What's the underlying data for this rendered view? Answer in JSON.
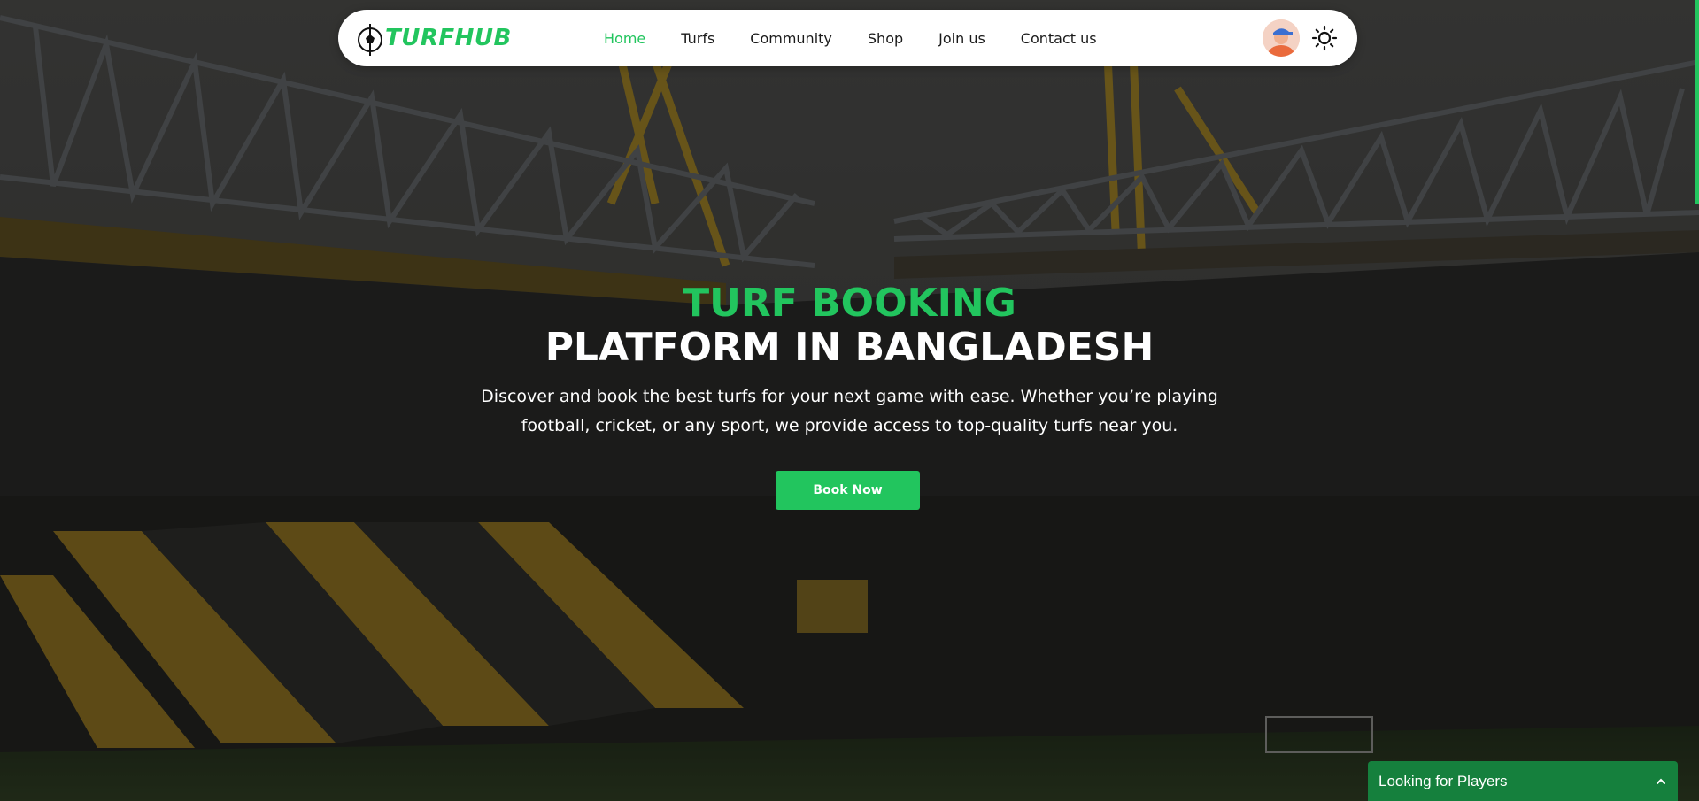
{
  "brand": {
    "name": "TURFHUB",
    "accent_color": "#22c55e"
  },
  "nav": {
    "items": [
      {
        "label": "Home",
        "active": true
      },
      {
        "label": "Turfs",
        "active": false
      },
      {
        "label": "Community",
        "active": false
      },
      {
        "label": "Shop",
        "active": false
      },
      {
        "label": "Join us",
        "active": false
      },
      {
        "label": "Contact us",
        "active": false
      }
    ],
    "avatar_icon": "user-avatar-icon",
    "theme_icon": "sun-icon"
  },
  "hero": {
    "title_line1": "TURF BOOKING",
    "title_line2": "PLATFORM IN BANGLADESH",
    "subtitle_line1": "Discover and book the best turfs for your next game with ease. Whether you’re playing",
    "subtitle_line2": "football, cricket, or any sport, we provide access to top-quality turfs near you.",
    "cta_label": "Book Now"
  },
  "widget": {
    "label": "Looking for Players",
    "icon": "chevron-up-icon",
    "color": "#15803d"
  }
}
